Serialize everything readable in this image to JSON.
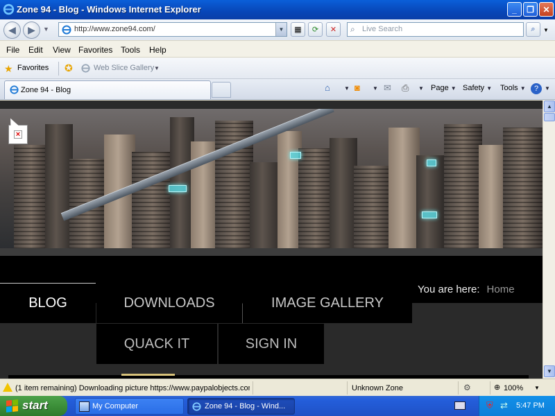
{
  "window": {
    "title": "Zone 94 - Blog - Windows Internet Explorer",
    "controls": {
      "minimize": "_",
      "maximize": "❐",
      "close": "✕"
    }
  },
  "address_bar": {
    "url": "http://www.zone94.com/",
    "search_placeholder": "Live Search"
  },
  "menu": {
    "items": [
      "File",
      "Edit",
      "View",
      "Favorites",
      "Tools",
      "Help"
    ]
  },
  "favorites_bar": {
    "favorites_label": "Favorites",
    "web_slice_label": "Web Slice Gallery"
  },
  "tabs": {
    "active_label": "Zone 94 - Blog"
  },
  "command_bar": {
    "page_label": "Page",
    "safety_label": "Safety",
    "tools_label": "Tools"
  },
  "page": {
    "nav_items": [
      "BLOG",
      "DOWNLOADS",
      "IMAGE GALLERY",
      "QUACK IT",
      "SIGN IN"
    ],
    "breadcrumb_label": "You are here:",
    "breadcrumb_home": "Home"
  },
  "status_bar": {
    "text": "(1 item remaining) Downloading picture https://www.paypalobjects.com...",
    "zone": "Unknown Zone",
    "zoom": "100%"
  },
  "taskbar": {
    "start_label": "start",
    "tasks": [
      "My Computer",
      "Zone 94 - Blog - Wind..."
    ],
    "clock": "5:47 PM"
  },
  "colors": {
    "titlebar": "#0846b8",
    "page_bg": "#2a2a2a",
    "nav_bg": "#000000",
    "taskbar": "#245edb",
    "start": "#3c8f39"
  }
}
